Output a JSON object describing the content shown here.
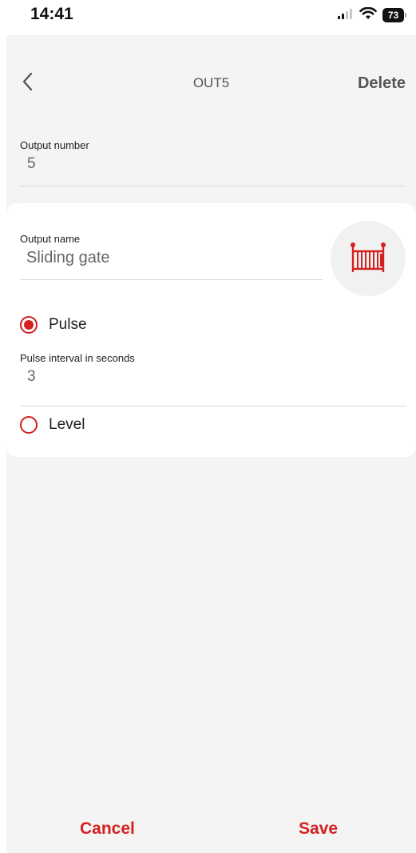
{
  "status_bar": {
    "time": "14:41",
    "battery_level": "73",
    "icons": [
      "signal-icon",
      "wifi-icon",
      "battery-icon"
    ]
  },
  "nav": {
    "title": "OUT5",
    "delete_label": "Delete",
    "back_icon": "chevron-left-icon"
  },
  "output_number": {
    "label": "Output number",
    "value": "5"
  },
  "output_name": {
    "label": "Output name",
    "value": "Sliding gate",
    "icon": "sliding-gate-icon"
  },
  "mode": {
    "pulse_label": "Pulse",
    "level_label": "Level",
    "selected": "pulse"
  },
  "pulse_interval": {
    "label": "Pulse interval in seconds",
    "value": "3"
  },
  "footer": {
    "cancel_label": "Cancel",
    "save_label": "Save"
  },
  "colors": {
    "accent": "#d32020",
    "background": "#f4f4f4",
    "card": "#ffffff",
    "muted_text": "#666666"
  }
}
